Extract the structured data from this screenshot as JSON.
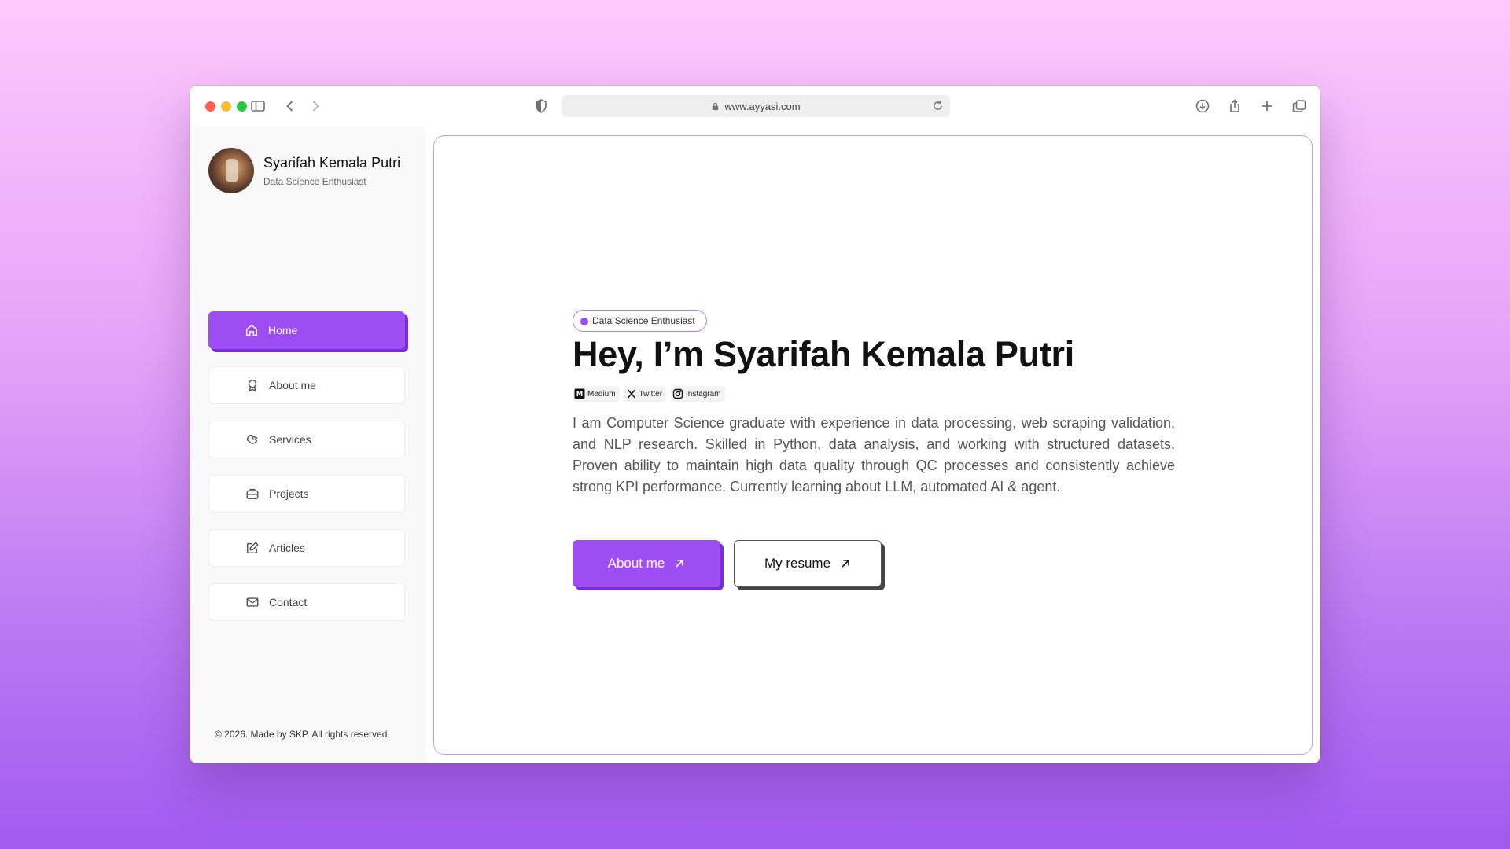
{
  "browser": {
    "url": "www.ayyasi.com"
  },
  "profile": {
    "name": "Syarifah Kemala Putri",
    "role": "Data Science Enthusiast"
  },
  "nav": {
    "items": [
      {
        "label": "Home",
        "icon": "home-icon",
        "active": true
      },
      {
        "label": "About me",
        "icon": "award-icon",
        "active": false
      },
      {
        "label": "Services",
        "icon": "handshake-icon",
        "active": false
      },
      {
        "label": "Projects",
        "icon": "briefcase-icon",
        "active": false
      },
      {
        "label": "Articles",
        "icon": "edit-icon",
        "active": false
      },
      {
        "label": "Contact",
        "icon": "mail-icon",
        "active": false
      }
    ]
  },
  "footer": {
    "copyright": "© 2026. Made by SKP. All rights reserved."
  },
  "hero": {
    "badge": "Data Science Enthusiast",
    "title": "Hey, I’m Syarifah Kemala Putri",
    "socials": [
      {
        "label": "Medium",
        "icon": "medium-icon"
      },
      {
        "label": "Twitter",
        "icon": "x-icon"
      },
      {
        "label": "Instagram",
        "icon": "instagram-icon"
      }
    ],
    "description": "I am Computer Science graduate with experience in data processing, web scraping validation, and NLP research. Skilled in Python, data analysis, and working with structured datasets. Proven ability to maintain high data quality through QC processes and consistently achieve strong KPI performance. Currently learning about LLM, automated AI & agent.",
    "primary_button": "About me",
    "secondary_button": "My resume"
  },
  "colors": {
    "accent": "#9d4ef2",
    "accent_shadow": "#7a2fd6"
  }
}
